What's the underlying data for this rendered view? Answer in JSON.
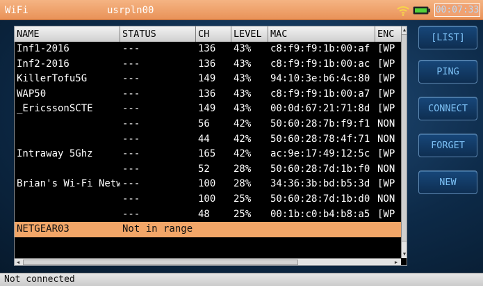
{
  "titlebar": {
    "app_name": "WiFi",
    "hostname": "usrpln00",
    "clock": "00:07:33",
    "status_icons": [
      "wifi-icon",
      "battery-icon"
    ]
  },
  "table": {
    "columns": [
      "NAME",
      "STATUS",
      "CH",
      "LEVEL",
      "MAC",
      "ENC"
    ],
    "rows": [
      {
        "name": "Inf1-2016",
        "status": "---",
        "ch": "136",
        "level": "43%",
        "mac": "c8:f9:f9:1b:00:af",
        "enc": "[WP"
      },
      {
        "name": "Inf2-2016",
        "status": "---",
        "ch": "136",
        "level": "43%",
        "mac": "c8:f9:f9:1b:00:ac",
        "enc": "[WP"
      },
      {
        "name": "KillerTofu5G",
        "status": "---",
        "ch": "149",
        "level": "43%",
        "mac": "94:10:3e:b6:4c:80",
        "enc": "[WP"
      },
      {
        "name": "WAP50",
        "status": "---",
        "ch": "136",
        "level": "43%",
        "mac": "c8:f9:f9:1b:00:a7",
        "enc": "[WP"
      },
      {
        "name": "_EricssonSCTE",
        "status": "---",
        "ch": "149",
        "level": "43%",
        "mac": "00:0d:67:21:71:8d",
        "enc": "[WP"
      },
      {
        "name": "",
        "status": "---",
        "ch": "56",
        "level": "42%",
        "mac": "50:60:28:7b:f9:f1",
        "enc": "NON"
      },
      {
        "name": "",
        "status": "---",
        "ch": "44",
        "level": "42%",
        "mac": "50:60:28:78:4f:71",
        "enc": "NON"
      },
      {
        "name": "Intraway 5Ghz",
        "status": "---",
        "ch": "165",
        "level": "42%",
        "mac": "ac:9e:17:49:12:5c",
        "enc": "[WP"
      },
      {
        "name": "",
        "status": "---",
        "ch": "52",
        "level": "28%",
        "mac": "50:60:28:7d:1b:f0",
        "enc": "NON"
      },
      {
        "name": "Brian's Wi-Fi Netw",
        "status": "---",
        "ch": "100",
        "level": "28%",
        "mac": "34:36:3b:bd:b5:3d",
        "enc": "[WP"
      },
      {
        "name": "",
        "status": "---",
        "ch": "100",
        "level": "25%",
        "mac": "50:60:28:7d:1b:d0",
        "enc": "NON"
      },
      {
        "name": "",
        "status": "---",
        "ch": "48",
        "level": "25%",
        "mac": "00:1b:c0:b4:b8:a5",
        "enc": "[WP"
      },
      {
        "name": "NETGEAR03",
        "status": "Not in range",
        "ch": "",
        "level": "",
        "mac": "",
        "enc": ""
      }
    ],
    "selected_row": 12
  },
  "buttons": {
    "list": "[LIST]",
    "ping": "PING",
    "connect": "CONNECT",
    "forget": "FORGET",
    "new": "NEW"
  },
  "statusbar": {
    "text": "Not connected"
  },
  "colors": {
    "titlebar": "#e99258",
    "selected_row": "#f2a668",
    "button_text": "#7cc0f5",
    "background": "#0b2238"
  }
}
